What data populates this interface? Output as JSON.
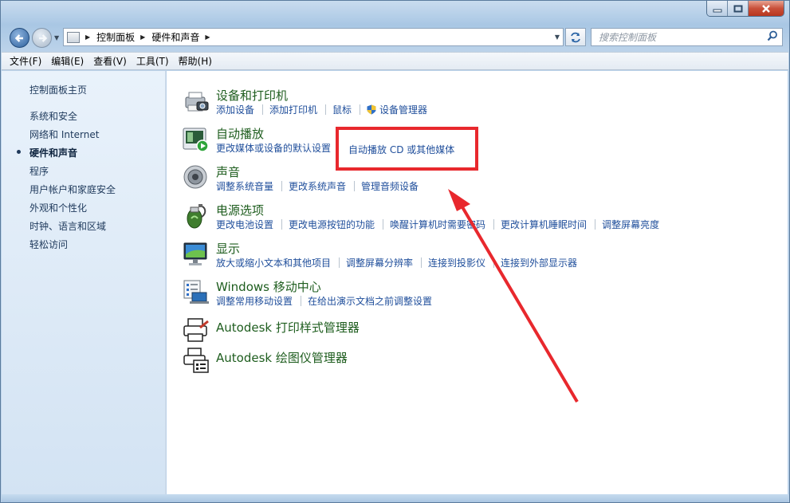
{
  "window": {
    "caption": {
      "minimize": "▭",
      "maximize": "□",
      "close": "✕"
    }
  },
  "address": {
    "crumbs": [
      "控制面板",
      "硬件和声音"
    ],
    "search_placeholder": "搜索控制面板"
  },
  "menu": [
    "文件(F)",
    "编辑(E)",
    "查看(V)",
    "工具(T)",
    "帮助(H)"
  ],
  "sidebar": {
    "home": "控制面板主页",
    "items": [
      "系统和安全",
      "网络和 Internet",
      "硬件和声音",
      "程序",
      "用户帐户和家庭安全",
      "外观和个性化",
      "时钟、语言和区域",
      "轻松访问"
    ],
    "active_index": 2
  },
  "categories": [
    {
      "title": "设备和打印机",
      "links": [
        "添加设备",
        "添加打印机",
        "鼠标",
        "设备管理器"
      ],
      "icon": "printer-camera-icon"
    },
    {
      "title": "自动播放",
      "links": [
        "更改媒体或设备的默认设置",
        "自动播放 CD 或其他媒体"
      ],
      "icon": "autoplay-icon"
    },
    {
      "title": "声音",
      "links": [
        "调整系统音量",
        "更改系统声音",
        "管理音频设备"
      ],
      "icon": "speaker-icon"
    },
    {
      "title": "电源选项",
      "links": [
        "更改电池设置",
        "更改电源按钮的功能",
        "唤醒计算机时需要密码",
        "更改计算机睡眠时间",
        "调整屏幕亮度"
      ],
      "icon": "power-battery-icon"
    },
    {
      "title": "显示",
      "links": [
        "放大或缩小文本和其他项目",
        "调整屏幕分辨率",
        "连接到投影仪",
        "连接到外部显示器"
      ],
      "icon": "display-icon"
    },
    {
      "title": "Windows 移动中心",
      "links": [
        "调整常用移动设置",
        "在给出演示文档之前调整设置"
      ],
      "icon": "mobility-center-icon"
    },
    {
      "title": "Autodesk 打印样式管理器",
      "links": [],
      "icon": "autodesk-printer-icon"
    },
    {
      "title": "Autodesk 绘图仪管理器",
      "links": [],
      "icon": "autodesk-plotter-icon"
    }
  ],
  "colors": {
    "highlight": "#e8282d",
    "link": "#1f4e9b",
    "title": "#1e5d1e"
  }
}
